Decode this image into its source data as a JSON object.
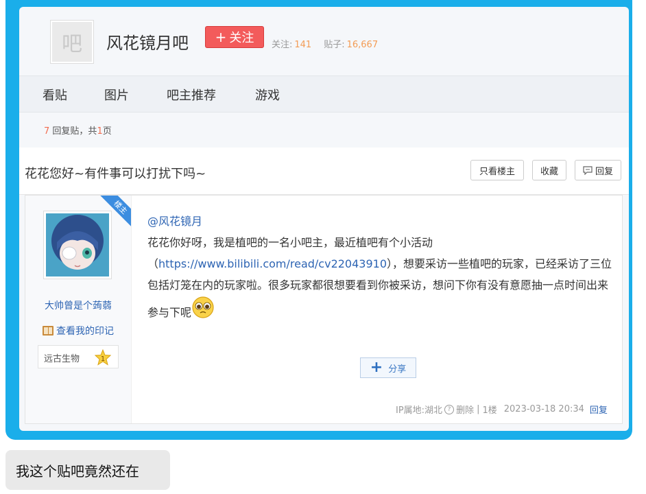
{
  "forum": {
    "avatar_char": "吧",
    "name": "风花镜月吧",
    "follow_label": "关注",
    "followers_label": "关注:",
    "followers_count": "141",
    "posts_label": "贴子:",
    "posts_count": "16,667"
  },
  "nav": {
    "items": [
      {
        "label": "看贴"
      },
      {
        "label": "图片"
      },
      {
        "label": "吧主推荐"
      },
      {
        "label": "游戏"
      }
    ]
  },
  "reply_info": {
    "count": "7",
    "text_mid": "回复贴，共",
    "pages": "1",
    "text_end": "页"
  },
  "thread": {
    "title": "花花您好~有件事可以打扰下吗~",
    "buttons": {
      "only_op": "只看楼主",
      "favorite": "收藏",
      "reply": "回复"
    }
  },
  "post": {
    "op_badge": "楼主",
    "author_name": "大帅曾是个蒟蒻",
    "imprint_label": "查看我的印记",
    "level_name": "远古生物",
    "level_number": "1",
    "mention": "@风花镜月",
    "text_1": "花花你好呀，我是植吧的一名小吧主，最近植吧有个小活动（",
    "link": "https://www.bilibili.com/read/cv22043910",
    "text_2": "），想要采访一些植吧的玩家，已经采访了三位包括灯笼在内的玩家啦。很多玩家都很想要看到你被采访，想问下你有没有意愿抽一点时间出来参与下呢",
    "share_label": "分享",
    "ip_location": "IP属地:湖北",
    "delete_label": "删除",
    "separator": "|",
    "floor": "1楼",
    "timestamp": "2023-03-18 20:34",
    "reply_label": "回复"
  },
  "chat": {
    "message": "我这个贴吧竟然还在"
  },
  "colors": {
    "frame_blue": "#1aaeea",
    "follow_red": "#f35b5b",
    "link_blue": "#2d64b3",
    "stat_orange": "#f39c55"
  }
}
